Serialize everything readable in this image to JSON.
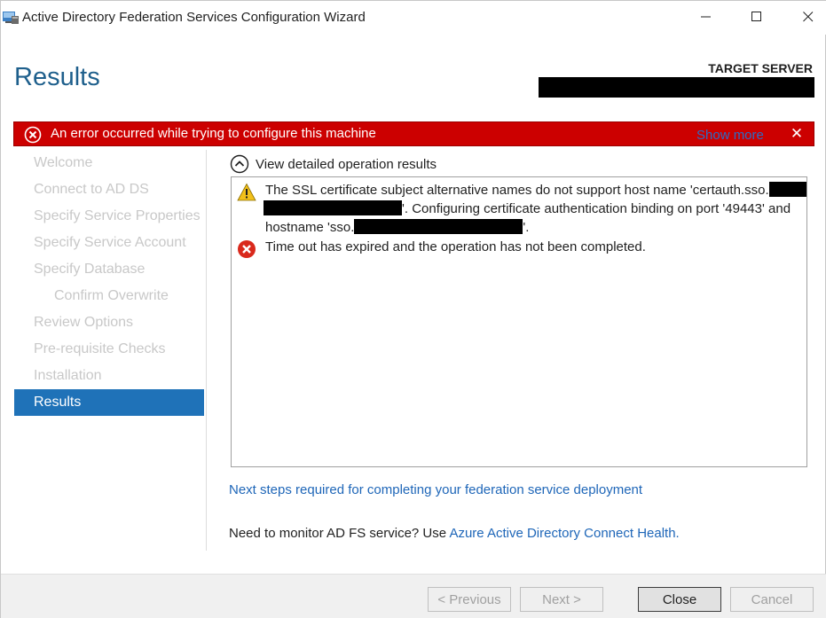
{
  "window": {
    "title": "Active Directory Federation Services Configuration Wizard",
    "minimize_label": "—",
    "maximize_label": "☐",
    "close_label": "✕"
  },
  "header": {
    "page_title": "Results",
    "target_server_label": "TARGET SERVER"
  },
  "banner": {
    "message": "An error occurred while trying to configure this machine",
    "show_more": "Show more",
    "close_glyph": "✕",
    "background_color": "#cc0000"
  },
  "sidebar": {
    "items": [
      {
        "label": "Welcome",
        "state": "disabled"
      },
      {
        "label": "Connect to AD DS",
        "state": "disabled"
      },
      {
        "label": "Specify Service Properties",
        "state": "disabled"
      },
      {
        "label": "Specify Service Account",
        "state": "disabled"
      },
      {
        "label": "Specify Database",
        "state": "disabled"
      },
      {
        "label": "Confirm Overwrite",
        "state": "disabled"
      },
      {
        "label": "Review Options",
        "state": "disabled"
      },
      {
        "label": "Pre-requisite Checks",
        "state": "disabled"
      },
      {
        "label": "Installation",
        "state": "disabled"
      },
      {
        "label": "Results",
        "state": "active"
      }
    ],
    "active_color": "#1f72b8"
  },
  "main": {
    "toggle_label": "View detailed operation results",
    "results": [
      {
        "icon": "warning-icon",
        "part1": "The SSL certificate subject alternative names do not support host name 'certauth.sso.",
        "part2": "'. Configuring certificate authentication binding on port '49443' and hostname 'sso.",
        "part3": "'."
      },
      {
        "icon": "error-icon",
        "text": "Time out has expired and the operation has not been completed."
      }
    ],
    "next_steps_link": "Next steps required for completing your federation service deployment",
    "monitor_prefix": "Need to monitor AD FS service? Use ",
    "monitor_link": "Azure Active Directory Connect Health."
  },
  "footer": {
    "previous": "< Previous",
    "next": "Next >",
    "close": "Close",
    "cancel": "Cancel"
  }
}
